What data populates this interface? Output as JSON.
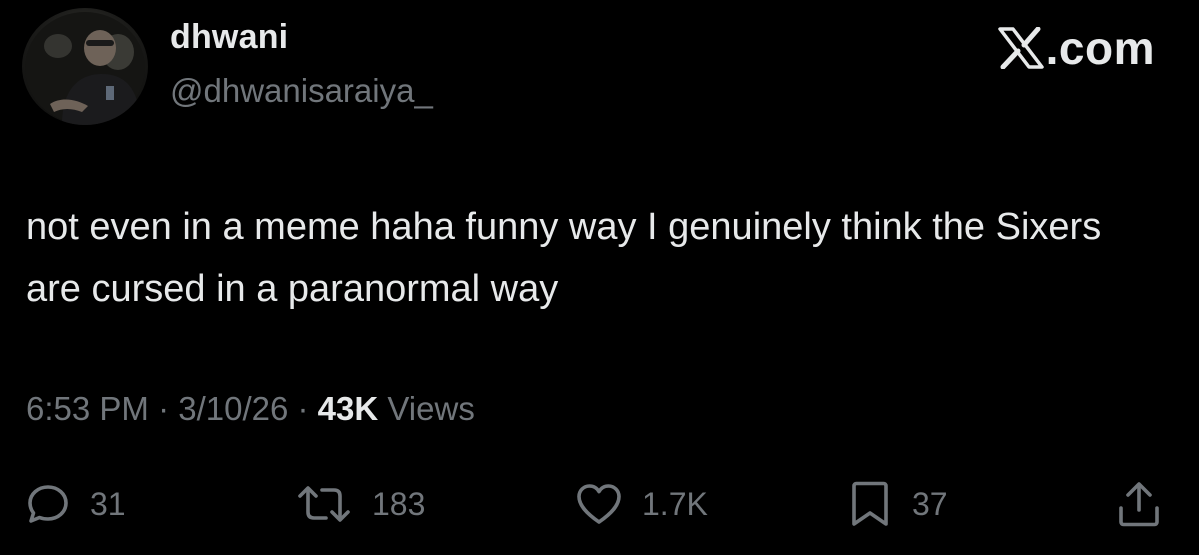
{
  "author": {
    "display_name": "dhwani",
    "handle": "@dhwanisaraiya_",
    "avatar_icon": "profile-photo"
  },
  "brand": {
    "domain": ".com",
    "icon": "x-logo-icon"
  },
  "tweet": {
    "text": "not even in a meme haha funny way I genuinely think the Sixers are cursed in a paranormal way"
  },
  "meta": {
    "time": "6:53 PM",
    "separator": " · ",
    "date": "3/10/26",
    "views_count": "43K",
    "views_label": "Views"
  },
  "actions": {
    "replies": {
      "icon": "reply-icon",
      "count": "31"
    },
    "reposts": {
      "icon": "repost-icon",
      "count": "183"
    },
    "likes": {
      "icon": "heart-icon",
      "count": "1.7K"
    },
    "bookmarks": {
      "icon": "bookmark-icon",
      "count": "37"
    },
    "share": {
      "icon": "share-icon"
    }
  },
  "colors": {
    "background": "#000000",
    "primary_text": "#e7e9ea",
    "secondary_text": "#71767b"
  }
}
